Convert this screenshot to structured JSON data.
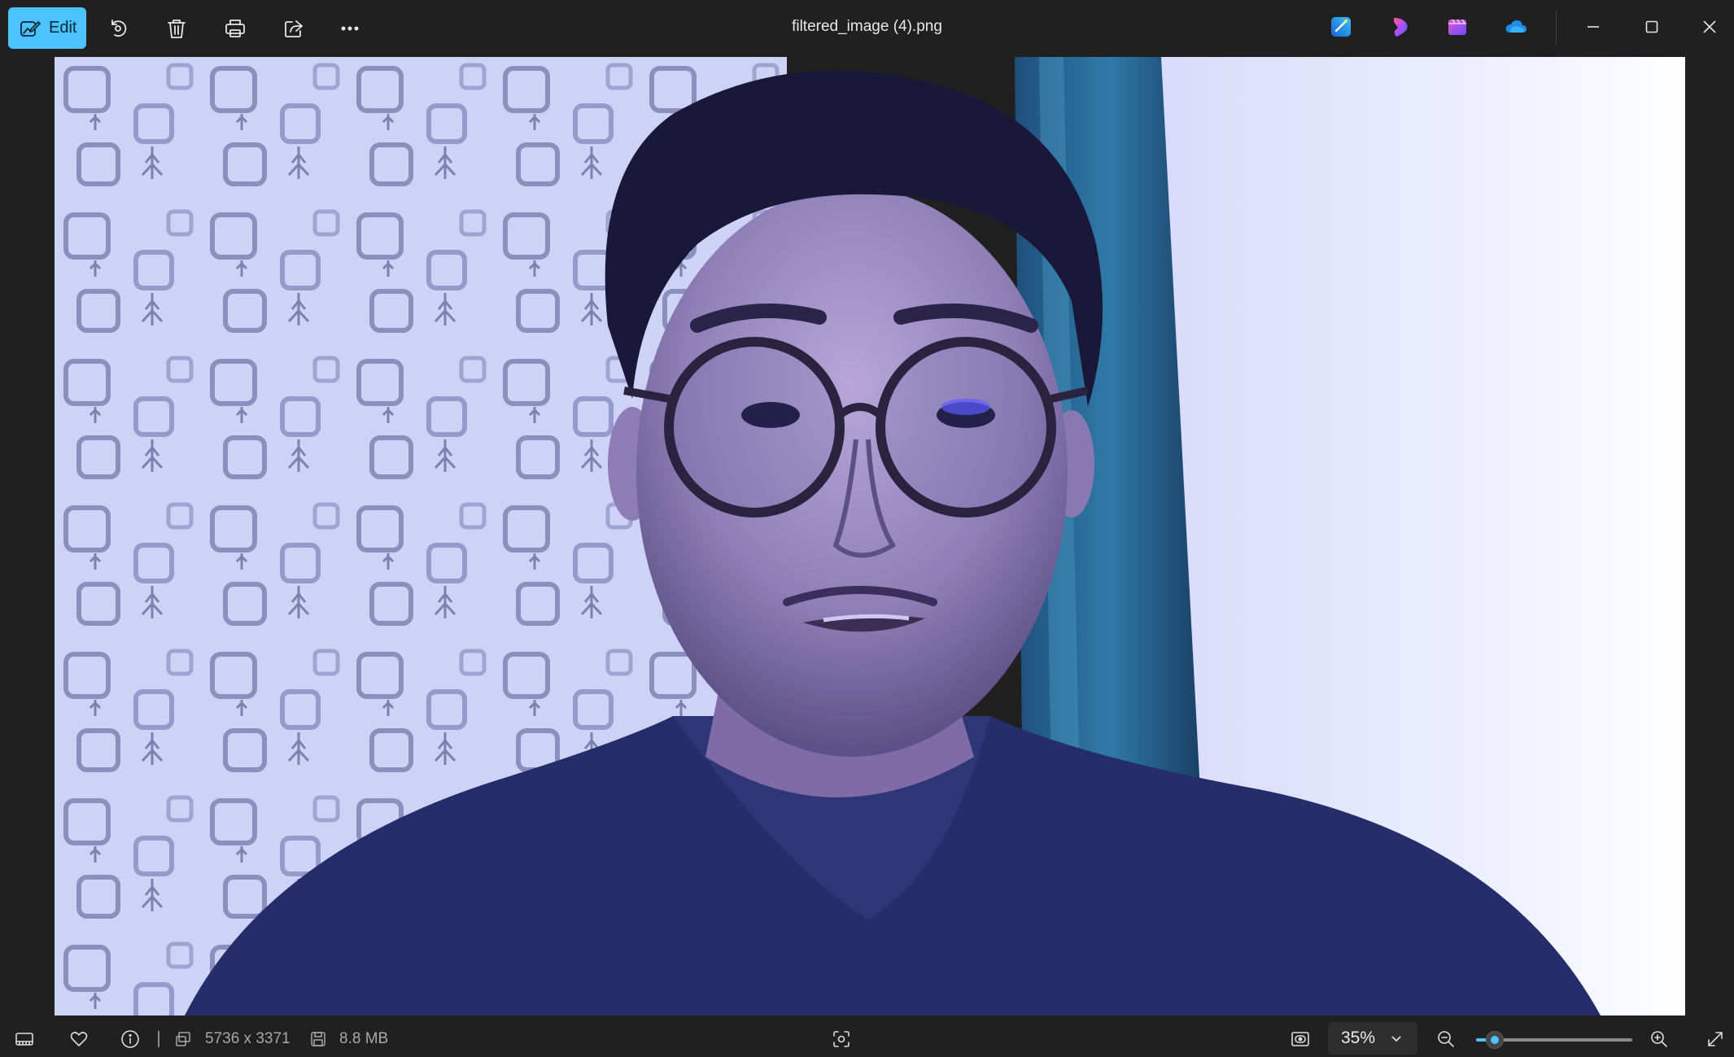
{
  "window": {
    "title": "filtered_image (4).png"
  },
  "toolbar": {
    "edit_label": "Edit",
    "icons": [
      "edit-image-icon",
      "rotate-icon",
      "delete-icon",
      "print-icon",
      "share-icon",
      "more-options-icon"
    ]
  },
  "app_icons": [
    "designer-icon",
    "clipchamp-icon",
    "copilot-icon",
    "onedrive-icon"
  ],
  "status": {
    "dimensions": "5736 x 3371",
    "file_size": "8.8 MB",
    "zoom_level": "35%",
    "zoom_fraction": 0.06
  },
  "colors": {
    "accent": "#4cc2ff",
    "background": "#202020",
    "toolbar_text": "#e8e8e8",
    "muted_text": "#a8a8a8"
  }
}
